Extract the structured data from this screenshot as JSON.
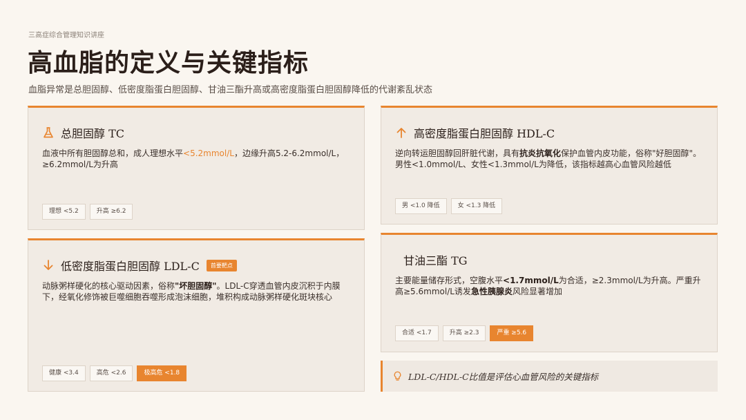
{
  "header": {
    "course": "三高症综合管理知识讲座",
    "title": "高血脂的定义与关键指标",
    "subtitle": "血脂异常是总胆固醇、低密度脂蛋白胆固醇、甘油三酯升高或高密度脂蛋白胆固醇降低的代谢紊乱状态"
  },
  "cards": {
    "tc": {
      "title": "总胆固醇 TC",
      "icon": "flask-icon",
      "text_1": "血液中所有胆固醇总和，成人理想水平",
      "highlight": "<5.2mmol/L",
      "text_2": "，边缘升高5.2-6.2mmol/L，≥6.2mmol/L为升高",
      "tags": [
        "理想 <5.2",
        "升高 ≥6.2"
      ]
    },
    "ldl": {
      "title": "低密度脂蛋白胆固醇 LDL-C",
      "icon": "arrow-down-icon",
      "badge": "首要靶点",
      "text_1": "动脉粥样硬化的核心驱动因素，俗称",
      "bold": "\"坏胆固醇\"",
      "text_2": "。LDL-C穿透血管内皮沉积于内膜下，经氧化修饰被巨噬细胞吞噬形成泡沫细胞，堆积构成动脉粥样硬化斑块核心",
      "tags": [
        "健康 <3.4",
        "高危 <2.6",
        "极高危 <1.8"
      ]
    },
    "hdl": {
      "title": "高密度脂蛋白胆固醇 HDL-C",
      "icon": "arrow-up-icon",
      "text_1": "逆向转运胆固醇回肝脏代谢，具有",
      "bold": "抗炎抗氧化",
      "text_2": "保护血管内皮功能，俗称\"好胆固醇\"。男性<1.0mmol/L、女性<1.3mmol/L为降低，该指标越高心血管风险越低",
      "tags": [
        "男 <1.0 降低",
        "女 <1.3 降低"
      ]
    },
    "tg": {
      "title": "甘油三酯 TG",
      "text_1": "主要能量储存形式，空腹水平",
      "bold_1": "<1.7mmol/L",
      "text_2": "为合适，≥2.3mmol/L为升高。严重升高≥5.6mmol/L诱发",
      "bold_2": "急性胰腺炎",
      "text_3": "风险显著增加",
      "tags": [
        "合适 <1.7",
        "升高 ≥2.3",
        "严重 ≥5.6"
      ]
    }
  },
  "note": {
    "icon": "lightbulb-icon",
    "text": "LDL-C/HDL-C比值是评估心血管风险的关键指标"
  },
  "colors": {
    "accent": "#e8852f",
    "card_bg": "#f1ebe4",
    "page_bg": "#faf6f0"
  }
}
